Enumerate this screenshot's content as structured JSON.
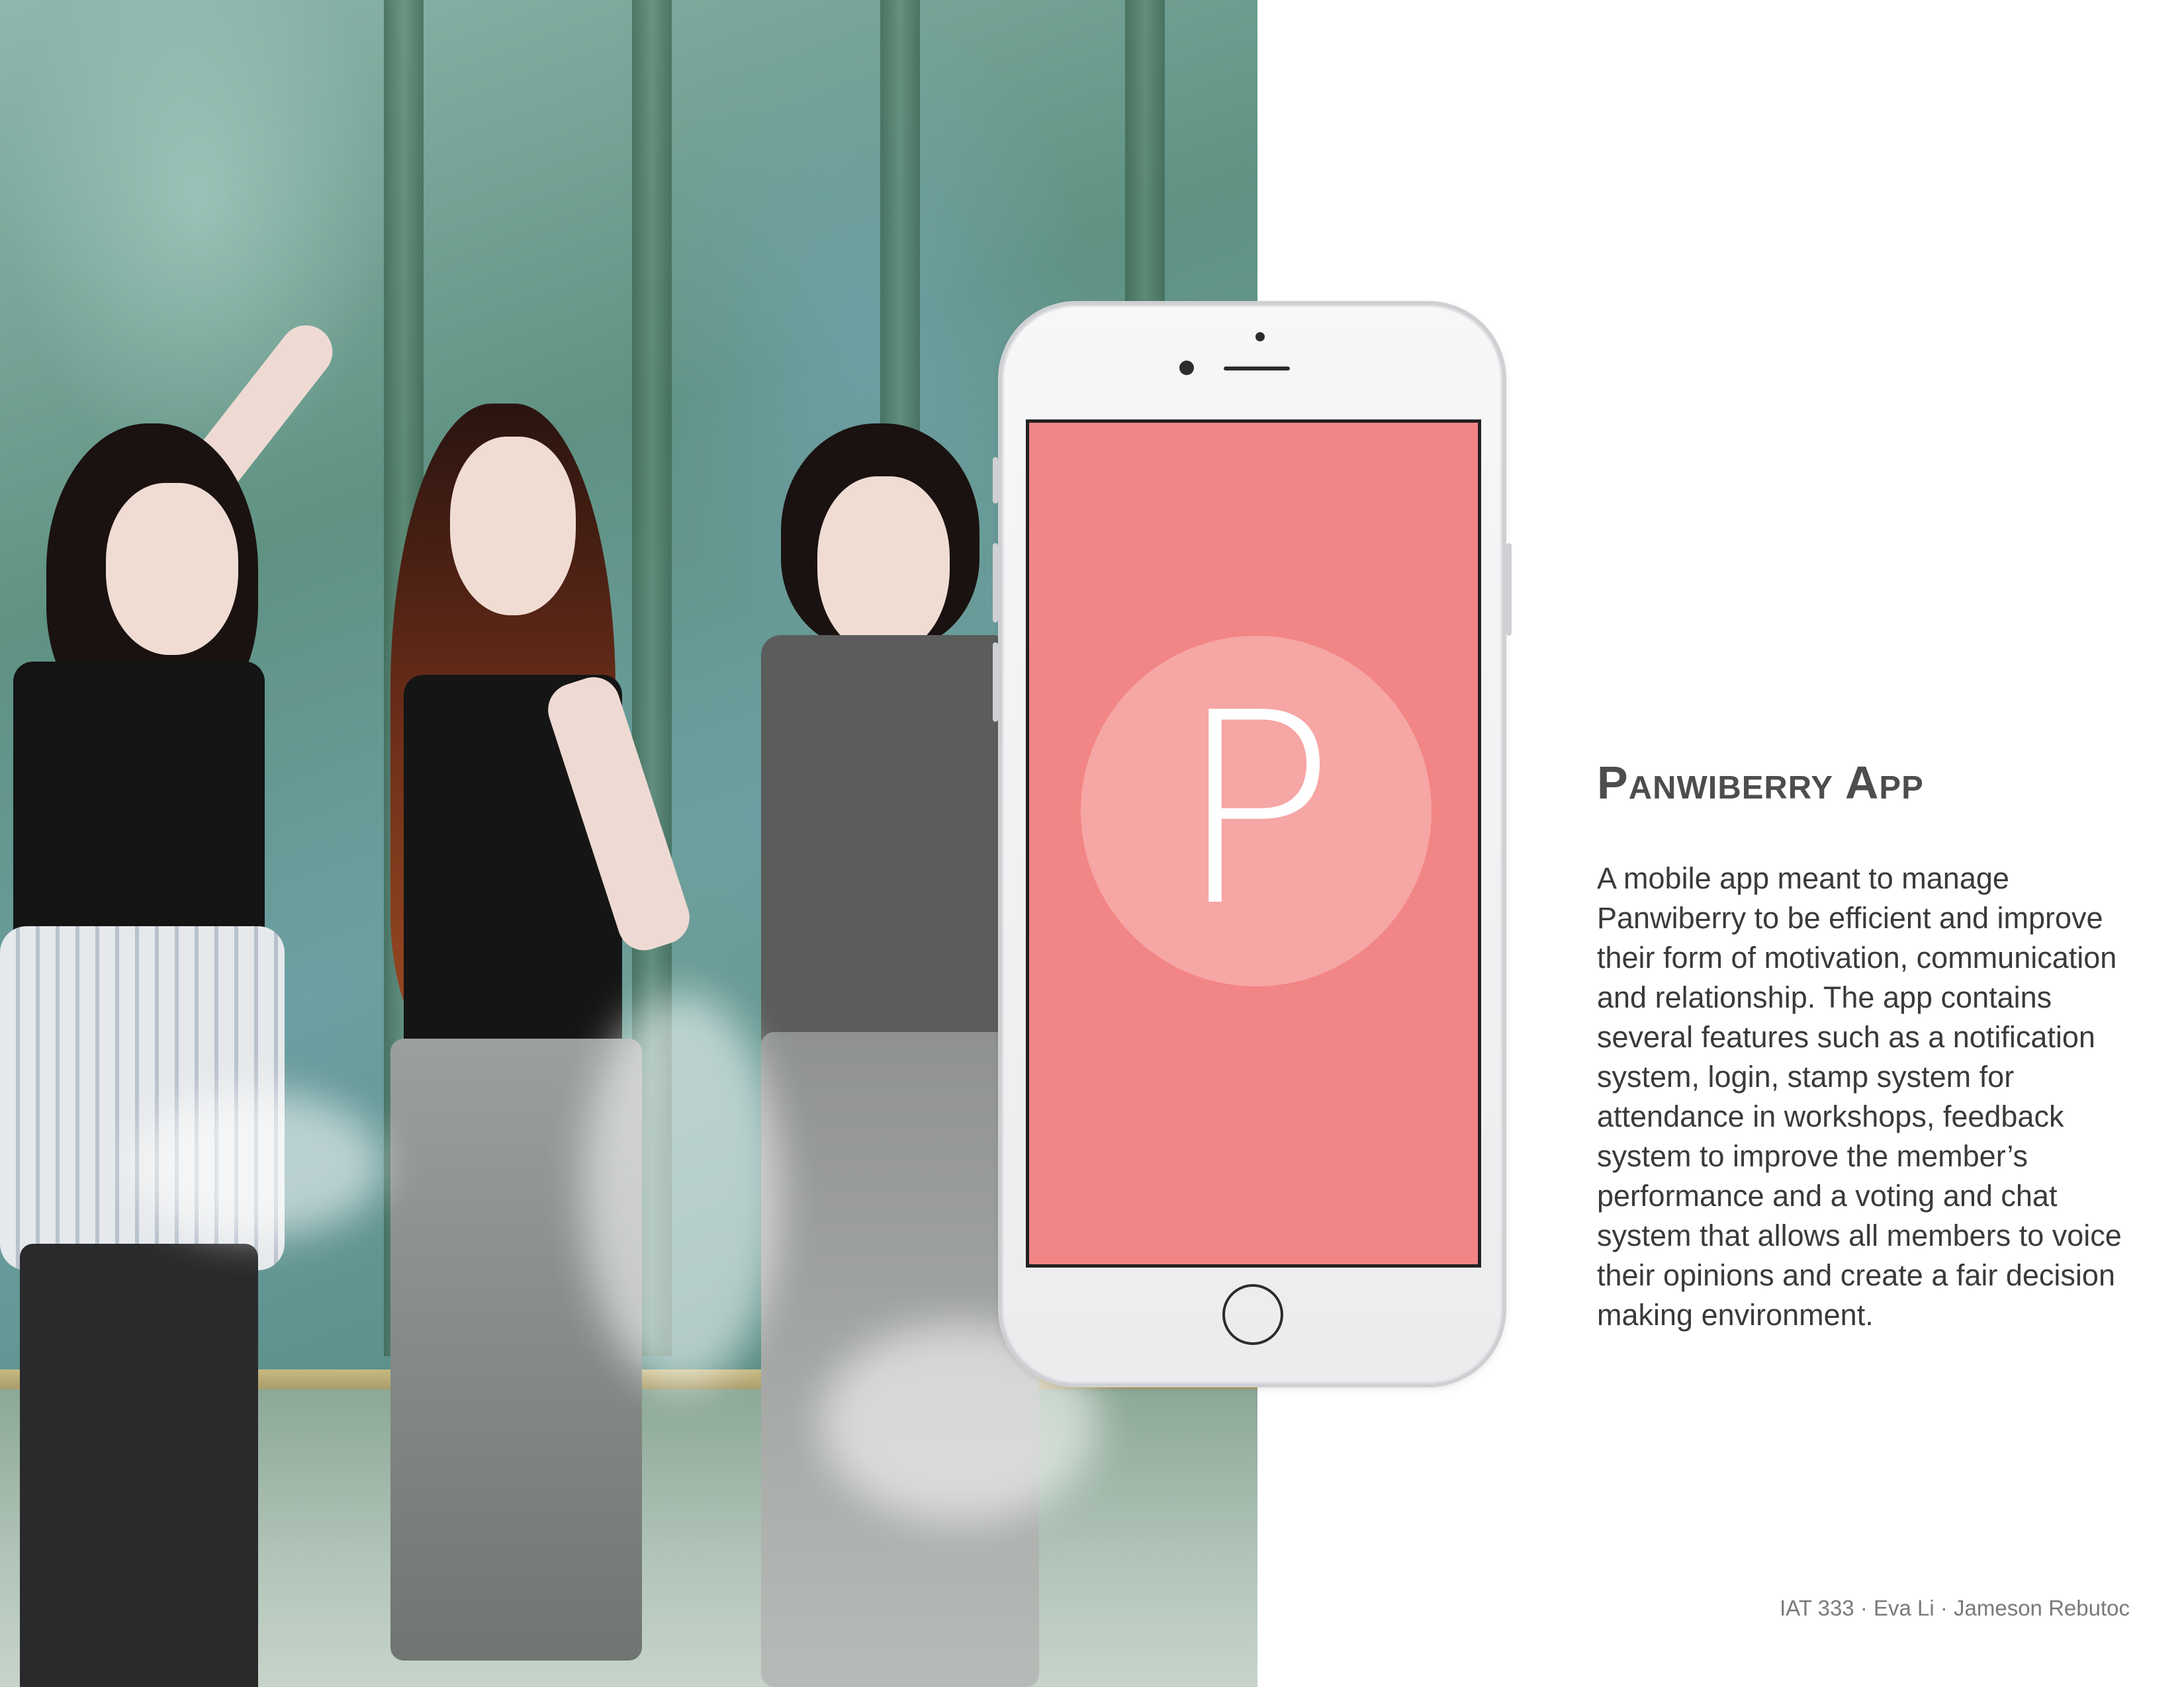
{
  "photo": {
    "icon": "group-photo-image"
  },
  "phone": {
    "screen_color": "#f28585",
    "logo_circle_color": "#f6a6a4",
    "logo_letter": "P"
  },
  "content": {
    "title": "Panwiberry App",
    "description": "A mobile app meant to manage Panwiberry to be efficient and improve their form of motivation, communication and relationship. The app contains several features such as a notification system, login, stamp system for attendance in workshops, feedback system to improve the member’s performance and a voting and chat system that allows all members to voice their opinions and create a fair decision making environment."
  },
  "footer": {
    "text": "IAT 333 · Eva Li · Jameson Rebutoc"
  }
}
